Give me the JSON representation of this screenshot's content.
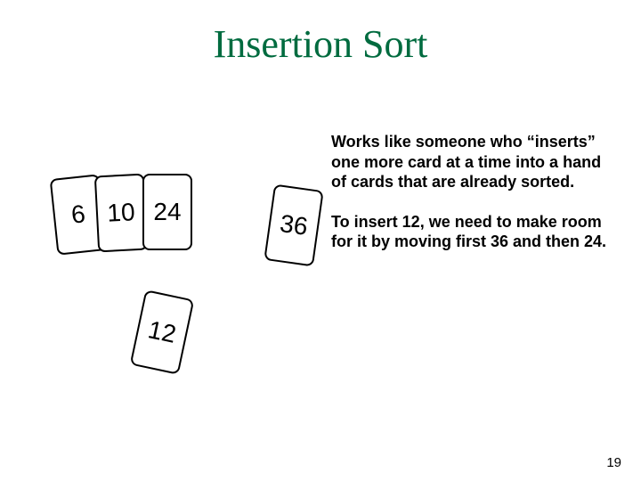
{
  "title": "Insertion Sort",
  "paragraphs": {
    "p1": "Works like someone who “inserts” one more card at a time into a hand of cards that are already sorted.",
    "p2": "To insert 12, we need to make room for it by moving first 36 and then 24."
  },
  "cards": {
    "c1": "6",
    "c2": "10",
    "c3": "24",
    "c4": "36",
    "c5": "12"
  },
  "page_number": "19"
}
